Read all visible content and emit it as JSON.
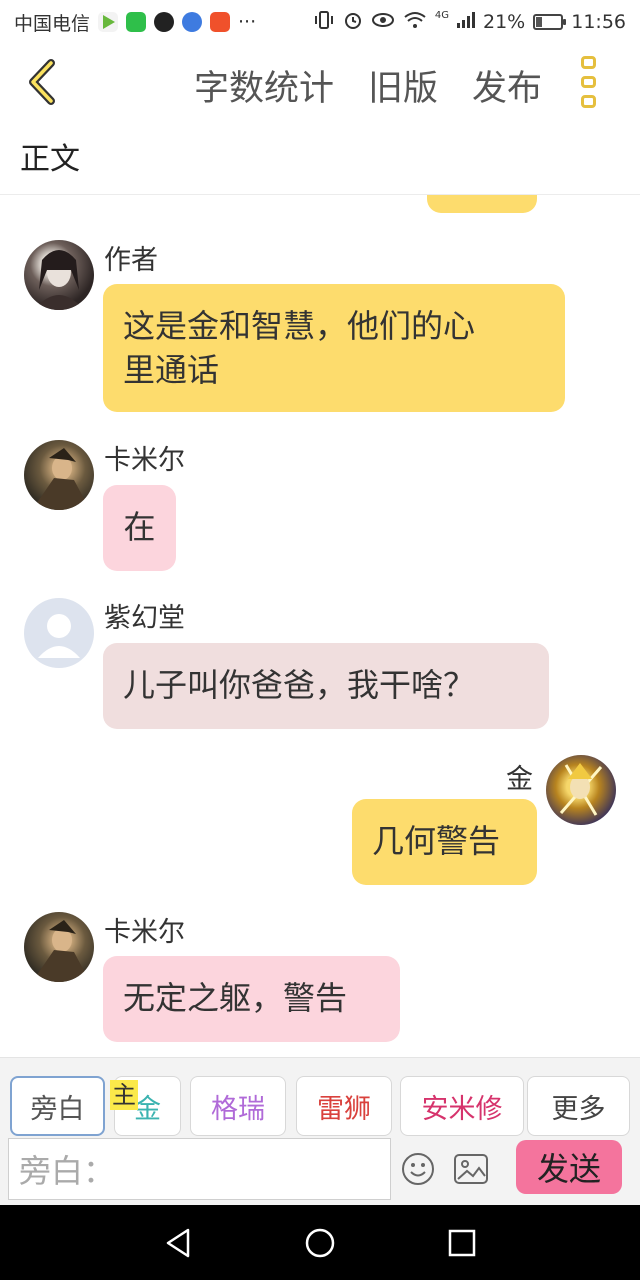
{
  "status_bar": {
    "carrier": "中国电信",
    "more": "···",
    "battery_text": "21%",
    "battery_level": 0.21,
    "time": "11:56",
    "network": "4G",
    "icons": [
      "play-app-icon",
      "iqiyi-icon",
      "tiktok-icon",
      "compass-app-icon",
      "taobao-icon",
      "vibrate-icon",
      "alarm-icon",
      "eye-icon",
      "wifi-icon",
      "signal-icon",
      "battery-icon"
    ]
  },
  "header": {
    "back_icon": "chevron-left-icon",
    "word_count": "字数统计",
    "old_version": "旧版",
    "publish": "发布",
    "menu_icon": "more-vertical-icon"
  },
  "section_title": "正文",
  "messages": [
    {
      "author": "作者",
      "text": "这是金和智慧，他们的心里通话",
      "line1": "这是金和智慧，他们的心",
      "line2": "里通话",
      "side": "left",
      "color": "#fddc6d"
    },
    {
      "author": "卡米尔",
      "text": "在",
      "side": "left",
      "color": "#fcd5dd"
    },
    {
      "author": "紫幻堂",
      "text": "儿子叫你爸爸，我干啥？",
      "side": "left",
      "color": "#f0dede"
    },
    {
      "author": "金",
      "text": "几何警告",
      "side": "right",
      "color": "#fddc6d"
    },
    {
      "author": "卡米尔",
      "text": "无定之躯，警告",
      "side": "left",
      "color": "#fcd5dd"
    }
  ],
  "roles": [
    {
      "label": "旁白",
      "color": "#555555"
    },
    {
      "label": "金",
      "color": "#3bb3b0"
    },
    {
      "label": "格瑞",
      "color": "#b06ad8"
    },
    {
      "label": "雷狮",
      "color": "#d9413c"
    },
    {
      "label": "安米修",
      "color": "#d6336c"
    },
    {
      "label": "更多",
      "color": "#444444"
    }
  ],
  "host_tag": "主",
  "input": {
    "placeholder": "旁白："
  },
  "icons": {
    "emoji": "smiley-icon",
    "image": "image-icon"
  },
  "send_label": "发送",
  "nav": [
    "back-triangle-icon",
    "home-circle-icon",
    "recent-square-icon"
  ]
}
